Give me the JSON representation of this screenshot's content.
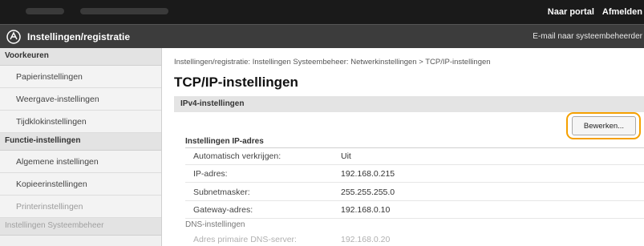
{
  "topbar": {
    "portal_link": "Naar portal",
    "logout_link": "Afmelden"
  },
  "header": {
    "title": "Instellingen/registratie",
    "mail_link": "E-mail naar systeembeheerder"
  },
  "sidebar": {
    "sections": [
      {
        "heading": "Voorkeuren",
        "items": [
          "Papierinstellingen",
          "Weergave-instellingen",
          "Tijdklokinstellingen"
        ]
      },
      {
        "heading": "Functie-instellingen",
        "items": [
          "Algemene instellingen",
          "Kopieerinstellingen",
          "Printerinstellingen"
        ]
      },
      {
        "heading": "Instellingen Systeembeheer",
        "items": []
      }
    ]
  },
  "main": {
    "breadcrumb": "Instellingen/registratie: Instellingen Systeembeheer: Netwerkinstellingen > TCP/IP-instellingen",
    "title": "TCP/IP-instellingen",
    "section_title": "IPv4-instellingen",
    "edit_button": "Bewerken...",
    "ip_section_title": "Instellingen IP-adres",
    "ip_rows": [
      {
        "label": "Automatisch verkrijgen:",
        "value": "Uit"
      },
      {
        "label": "IP-adres:",
        "value": "192.168.0.215"
      },
      {
        "label": "Subnetmasker:",
        "value": "255.255.255.0"
      },
      {
        "label": "Gateway-adres:",
        "value": "192.168.0.10"
      }
    ],
    "dns_section_title": "DNS-instellingen",
    "dns_rows": [
      {
        "label": "Adres primaire DNS-server:",
        "value": "192.168.0.20"
      }
    ]
  },
  "colors": {
    "highlight_ring": "#f5a000",
    "topbar": "#1a1a1a",
    "titlebar": "#3c3c3c"
  }
}
